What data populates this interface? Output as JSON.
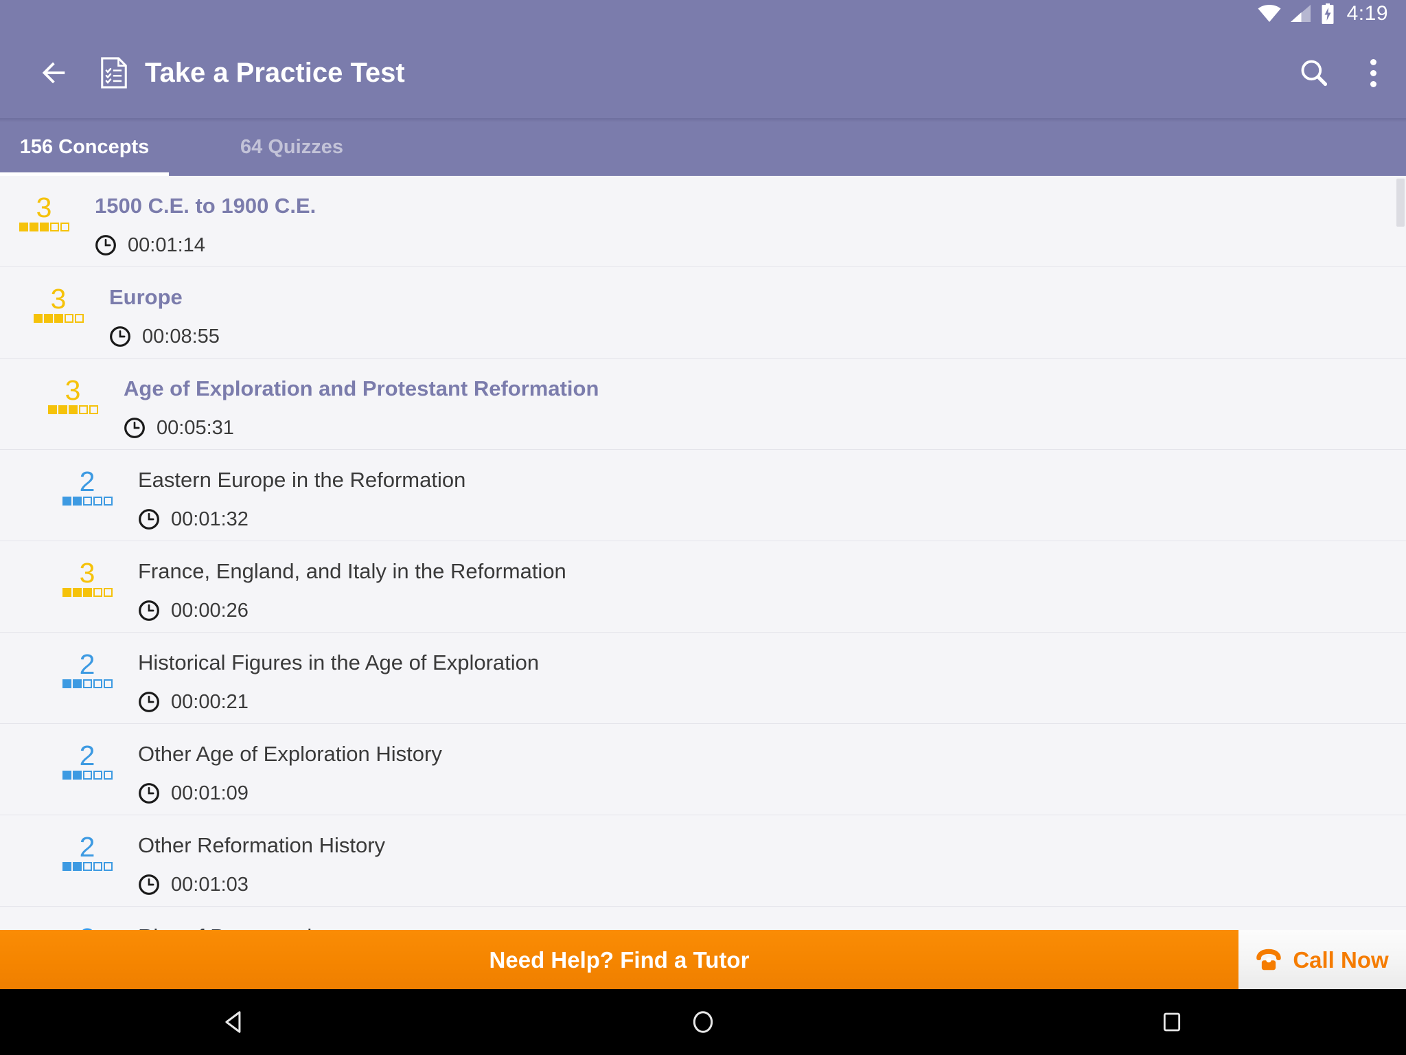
{
  "statusbar": {
    "time": "4:19",
    "icons": [
      "wifi-icon",
      "cell-signal-icon",
      "battery-charging-icon"
    ]
  },
  "appbar": {
    "back_label": "back-arrow-icon",
    "doc_icon": "practice-test-document-icon",
    "title": "Take a Practice Test",
    "search_icon": "search-icon",
    "overflow_icon": "overflow-menu-icon",
    "background_color": "#7b7cac"
  },
  "tabs": [
    {
      "label": "156 Concepts",
      "active": true
    },
    {
      "label": "64 Quizzes",
      "active": false
    }
  ],
  "colors": {
    "accent_purple": "#7b7cac",
    "level_yellow": "#f5c20a",
    "level_blue": "#3d9ae2",
    "banner_orange": "#f58500",
    "call_now_orange": "#f57c00",
    "row_background": "#f5f5f8",
    "child_text": "#3a3a3a"
  },
  "list": {
    "clock_icon": "clock-icon",
    "max_level": 5,
    "rows": [
      {
        "title": "1500 C.E. to 1900 C.E.",
        "level": 3,
        "level_color": "yellow",
        "time": "00:01:14",
        "indent": 0,
        "style": "parent"
      },
      {
        "title": "Europe",
        "level": 3,
        "level_color": "yellow",
        "time": "00:08:55",
        "indent": 1,
        "style": "parent"
      },
      {
        "title": "Age of Exploration and Protestant Reformation",
        "level": 3,
        "level_color": "yellow",
        "time": "00:05:31",
        "indent": 2,
        "style": "parent"
      },
      {
        "title": "Eastern Europe in the Reformation",
        "level": 2,
        "level_color": "blue",
        "time": "00:01:32",
        "indent": 3,
        "style": "child"
      },
      {
        "title": "France, England, and Italy in the Reformation",
        "level": 3,
        "level_color": "yellow",
        "time": "00:00:26",
        "indent": 3,
        "style": "child"
      },
      {
        "title": "Historical Figures in the Age of Exploration",
        "level": 2,
        "level_color": "blue",
        "time": "00:00:21",
        "indent": 3,
        "style": "child"
      },
      {
        "title": "Other Age of Exploration History",
        "level": 2,
        "level_color": "blue",
        "time": "00:01:09",
        "indent": 3,
        "style": "child"
      },
      {
        "title": "Other Reformation History",
        "level": 2,
        "level_color": "blue",
        "time": "00:01:03",
        "indent": 3,
        "style": "child"
      },
      {
        "title": "Rise of Protestantism",
        "level": 2,
        "level_color": "blue",
        "time": "",
        "indent": 3,
        "style": "child"
      }
    ]
  },
  "banner": {
    "text": "Need Help? Find a Tutor",
    "call_label": "Call Now",
    "phone_icon": "phone-icon"
  },
  "navbar": {
    "back": "nav-back-icon",
    "home": "nav-home-icon",
    "recents": "nav-recents-icon"
  }
}
